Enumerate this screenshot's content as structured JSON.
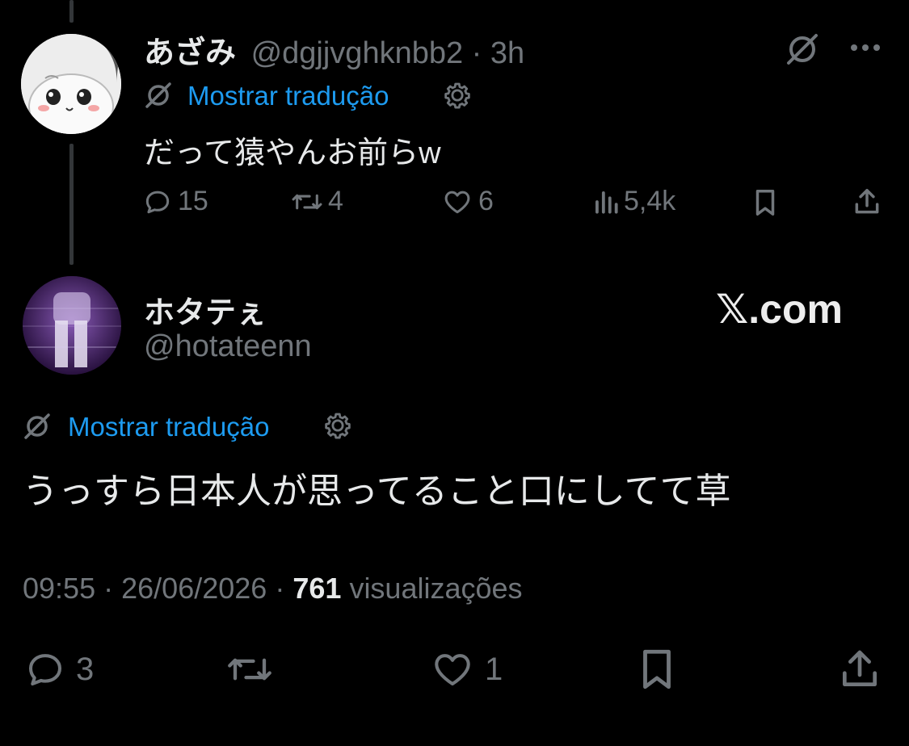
{
  "parent_tweet": {
    "display_name": "あざみ",
    "handle": "@dgjjvghknbb2",
    "separator": "·",
    "time": "3h",
    "translate_label": "Mostrar tradução",
    "text": "だって猿やんお前らw",
    "actions": {
      "replies": "15",
      "reposts": "4",
      "likes": "6",
      "views": "5,4k"
    }
  },
  "main_tweet": {
    "display_name": "ホタテぇ",
    "handle": "@hotateenn",
    "translate_label": "Mostrar tradução",
    "text": "うっすら日本人が思ってること口にしてて草",
    "meta": {
      "time": "09:55",
      "sep1": "·",
      "date": "26/06/2026",
      "sep2": "·",
      "views_count": "761",
      "views_label": "visualizações"
    },
    "actions": {
      "replies": "3",
      "likes": "1"
    }
  },
  "watermark": "𝕏.com",
  "colors": {
    "background": "#000000",
    "text": "#e7e9ea",
    "muted": "#71767b",
    "link": "#1d9bf0"
  }
}
